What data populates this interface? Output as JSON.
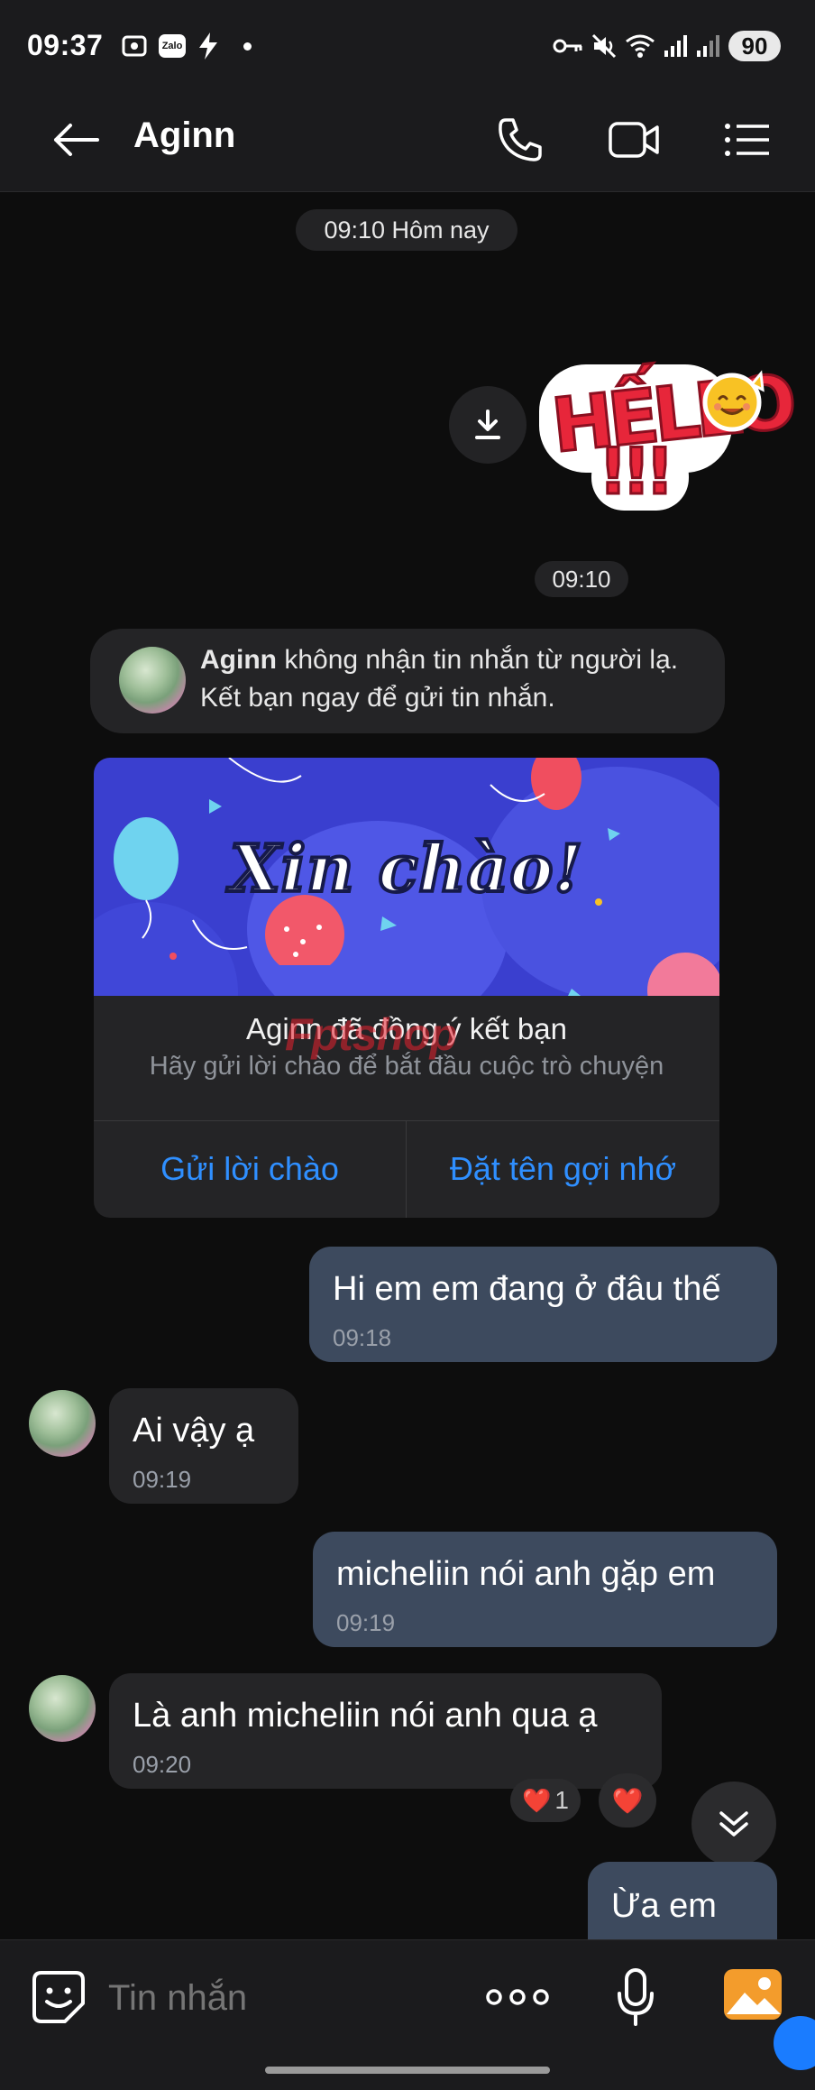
{
  "status_bar": {
    "time": "09:37",
    "battery": "90",
    "zalo_label": "Zalo"
  },
  "header": {
    "contact_name": "Aginn"
  },
  "date_chip": "09:10 Hôm nay",
  "sticker": {
    "text": "HẾLLO",
    "exclaim": "!!!",
    "time": "09:10"
  },
  "notice": {
    "name": "Aginn",
    "line1_rest": " không nhận tin nhắn từ người lạ.",
    "line2": "Kết bạn ngay để gửi tin nhắn."
  },
  "friend_card": {
    "banner_text": "Xin chào!",
    "title": "Aginn đã đồng ý kết bạn",
    "subtitle": "Hãy gửi lời chào để bắt đầu cuộc trò chuyện",
    "watermark": "Fptshop",
    "button_greet": "Gửi lời chào",
    "button_nickname": "Đặt tên gợi nhớ"
  },
  "messages": [
    {
      "direction": "out",
      "text": "Hi em em đang ở đâu thế",
      "time": "09:18"
    },
    {
      "direction": "in",
      "text": "Ai vậy ạ",
      "time": "09:19"
    },
    {
      "direction": "out",
      "text": "micheliin nói anh gặp em",
      "time": "09:19"
    },
    {
      "direction": "in",
      "text": "Là anh micheliin nói anh qua ạ",
      "time": "09:20"
    },
    {
      "direction": "out",
      "text": "Ừa em",
      "time": ""
    }
  ],
  "reactions": {
    "count": "1",
    "emoji": "❤️"
  },
  "input": {
    "placeholder": "Tin nhắn"
  },
  "colors": {
    "accent": "#2f8fff",
    "bubble_out": "#3d4a5e",
    "bubble_in": "#252527"
  }
}
